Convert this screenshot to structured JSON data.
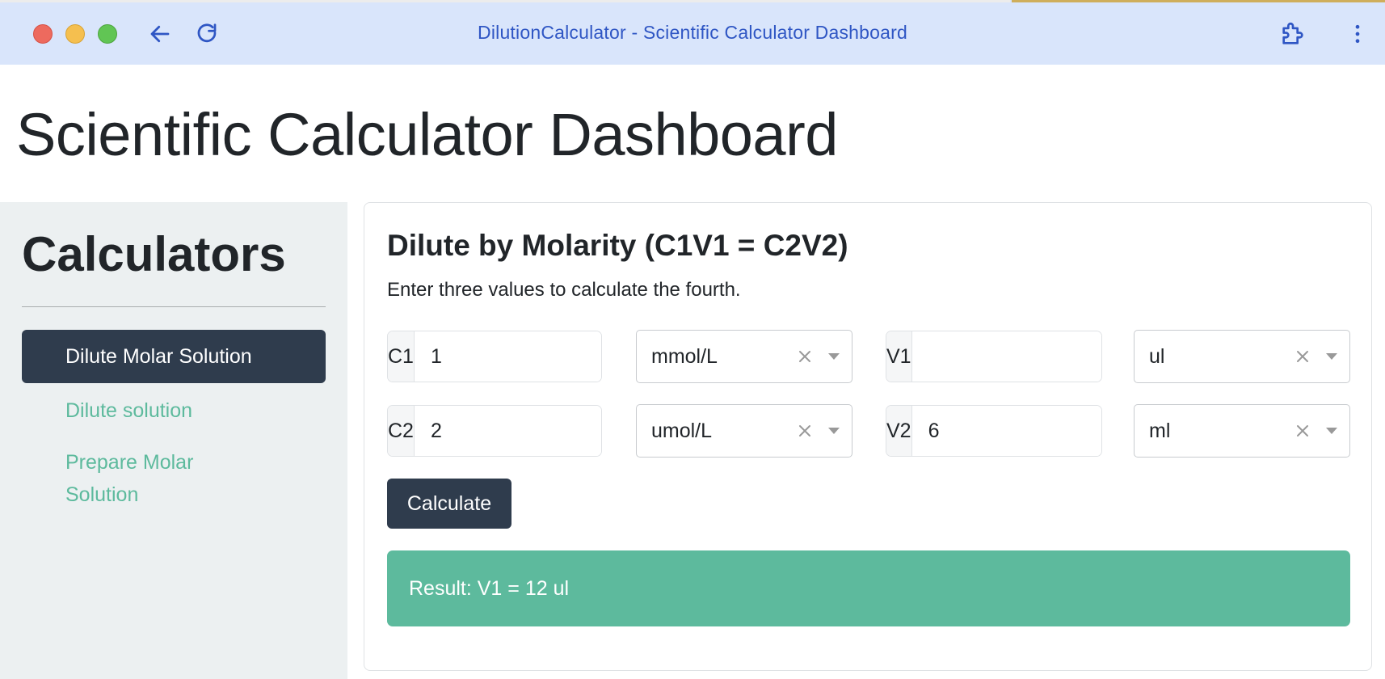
{
  "browser": {
    "window_title": "DilutionCalculator - Scientific Calculator Dashboard"
  },
  "page": {
    "title": "Scientific Calculator Dashboard"
  },
  "sidebar": {
    "heading": "Calculators",
    "items": [
      {
        "label": "Dilute Molar Solution",
        "active": true
      },
      {
        "label": "Dilute solution",
        "active": false
      },
      {
        "label": "Prepare Molar Solution",
        "active": false
      }
    ]
  },
  "calculator": {
    "title": "Dilute by Molarity (C1V1 = C2V2)",
    "subtitle": "Enter three values to calculate the fourth.",
    "rows": [
      {
        "conc_label": "C1",
        "conc_value": "1",
        "conc_unit": "mmol/L",
        "vol_label": "V1",
        "vol_value": "",
        "vol_unit": "ul"
      },
      {
        "conc_label": "C2",
        "conc_value": "2",
        "conc_unit": "umol/L",
        "vol_label": "V2",
        "vol_value": "6",
        "vol_unit": "ml"
      }
    ],
    "button_label": "Calculate",
    "result": "Result: V1 = 12 ul"
  },
  "colors": {
    "primary_dark": "#2f3c4d",
    "accent_green": "#5dba9d",
    "chrome_bg": "#d9e5fb",
    "sidebar_bg": "#ecf0f1"
  }
}
